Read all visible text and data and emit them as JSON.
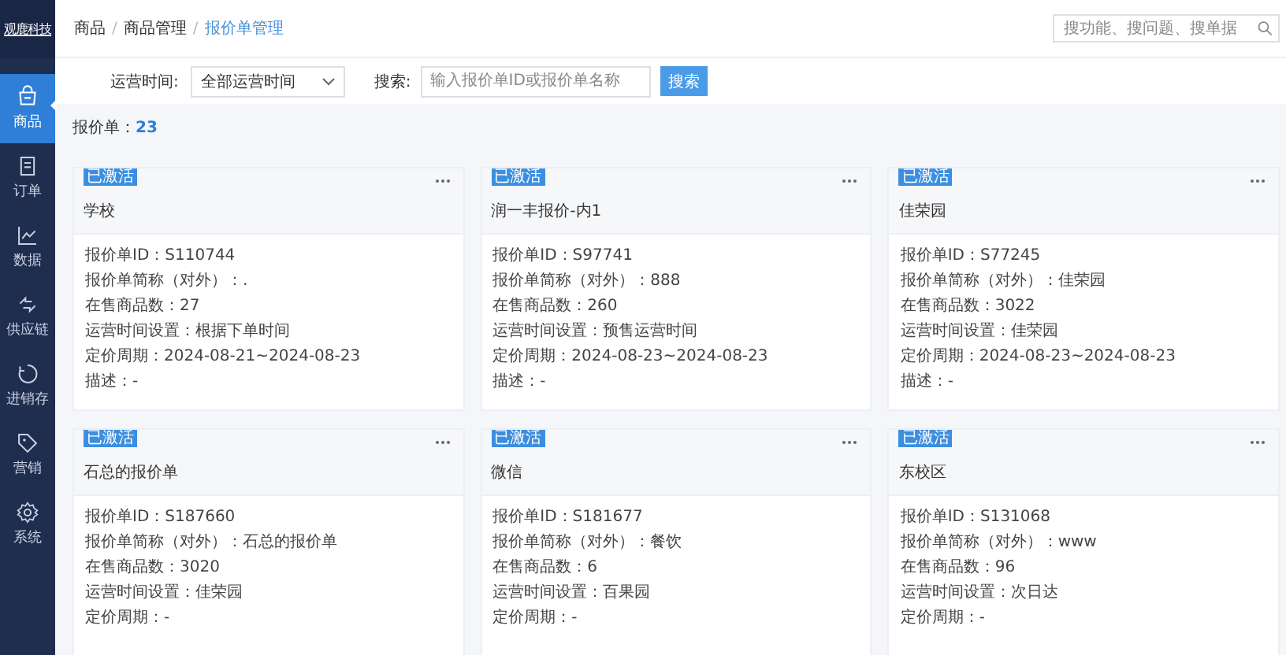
{
  "sidebar": {
    "logo": "观鹿科技",
    "items": [
      {
        "label": "商品",
        "kind": "bag",
        "selected": true
      },
      {
        "label": "订单",
        "kind": "doc",
        "selected": false
      },
      {
        "label": "数据",
        "kind": "chart",
        "selected": false
      },
      {
        "label": "供应链",
        "kind": "arrows",
        "selected": false
      },
      {
        "label": "进销存",
        "kind": "cycle",
        "selected": false
      },
      {
        "label": "营销",
        "kind": "tag",
        "selected": false
      },
      {
        "label": "系统",
        "kind": "gear",
        "selected": false
      }
    ]
  },
  "breadcrumb": {
    "items": [
      "商品",
      "商品管理",
      "报价单管理"
    ],
    "separator": "/"
  },
  "global_search": {
    "placeholder": "搜功能、搜问题、搜单据"
  },
  "filters": {
    "time_label": "运营时间:",
    "time_value": "全部运营时间",
    "search_label": "搜索:",
    "search_placeholder": "输入报价单ID或报价单名称",
    "search_button": "搜索"
  },
  "count": {
    "label": "报价单：",
    "value": "23"
  },
  "cards": [
    {
      "status": "已激活",
      "title": "学校",
      "lines": [
        "报价单ID：S110744",
        "报价单简称（对外）：.",
        "在售商品数：27",
        "运营时间设置：根据下单时间",
        "定价周期：2024-08-21~2024-08-23",
        "描述：-"
      ]
    },
    {
      "status": "已激活",
      "title": "润一丰报价-内1",
      "lines": [
        "报价单ID：S97741",
        "报价单简称（对外）：888",
        "在售商品数：260",
        "运营时间设置：预售运营时间",
        "定价周期：2024-08-23~2024-08-23",
        "描述：-"
      ]
    },
    {
      "status": "已激活",
      "title": "佳荣园",
      "lines": [
        "报价单ID：S77245",
        "报价单简称（对外）：佳荣园",
        "在售商品数：3022",
        "运营时间设置：佳荣园",
        "定价周期：2024-08-23~2024-08-23",
        "描述：-"
      ]
    },
    {
      "status": "已激活",
      "title": "石总的报价单",
      "lines": [
        "报价单ID：S187660",
        "报价单简称（对外）：石总的报价单",
        "在售商品数：3020",
        "运营时间设置：佳荣园",
        "定价周期：-"
      ]
    },
    {
      "status": "已激活",
      "title": "微信",
      "lines": [
        "报价单ID：S181677",
        "报价单简称（对外）：餐饮",
        "在售商品数：6",
        "运营时间设置：百果园",
        "定价周期：-"
      ]
    },
    {
      "status": "已激活",
      "title": "东校区",
      "lines": [
        "报价单ID：S131068",
        "报价单简称（对外）：www",
        "在售商品数：96",
        "运营时间设置：次日达",
        "定价周期：-"
      ]
    }
  ]
}
